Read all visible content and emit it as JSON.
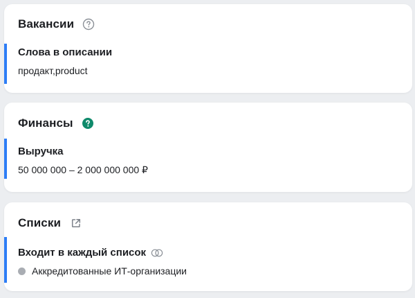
{
  "vacancies": {
    "title": "Вакансии",
    "help_icon": "question-circle-outline-icon",
    "filter": {
      "label": "Слова в описании",
      "value": "продакт,product"
    }
  },
  "finance": {
    "title": "Финансы",
    "help_icon": "question-circle-filled-icon",
    "help_icon_color": "#0f8a6b",
    "filter": {
      "label": "Выручка",
      "value": "50 000 000 – 2 000 000 000 ₽"
    }
  },
  "lists": {
    "title": "Списки",
    "external_icon": "external-link-icon",
    "filter": {
      "label": "Входит в каждый список",
      "mode_icon": "intersection-circles-icon",
      "items": [
        {
          "label": "Аккредитованные ИТ-организации"
        }
      ]
    }
  },
  "accent_color": "#2d7df6"
}
